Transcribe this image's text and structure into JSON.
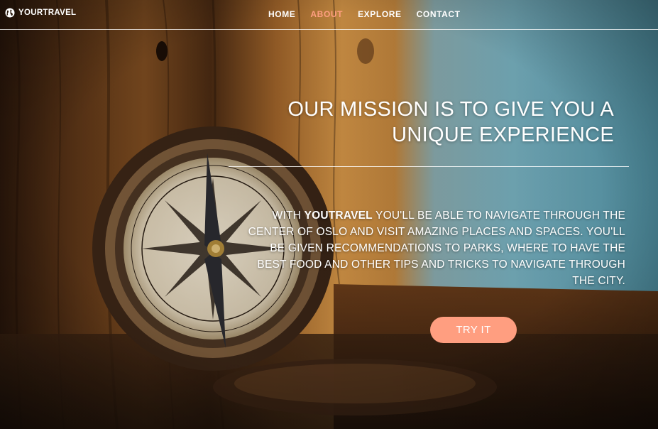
{
  "brand": {
    "name": "YOURTRAVEL",
    "icon": "globe-icon"
  },
  "nav": {
    "home": "HOME",
    "about": "ABOUT",
    "explore": "EXPLORE",
    "contact": "CONTACT",
    "active": "about"
  },
  "hero": {
    "headline": "OUR MISSION IS TO GIVE YOU A UNIQUE EXPERIENCE",
    "description_prefix": "WITH ",
    "description_brand": "YOUTRAVEL",
    "description_rest": " YOU'LL BE ABLE TO NAVIGATE THROUGH THE CENTER OF OSLO AND VISIT AMAZING PLACES AND SPACES. YOU'LL BE GIVEN RECOMMENDATIONS TO PARKS, WHERE TO HAVE THE BEST FOOD AND OTHER TIPS AND TRICKS TO NAVIGATE THROUGH THE CITY.",
    "cta_label": "TRY IT"
  },
  "colors": {
    "accent": "#ff9e80",
    "text": "#ffffff"
  }
}
